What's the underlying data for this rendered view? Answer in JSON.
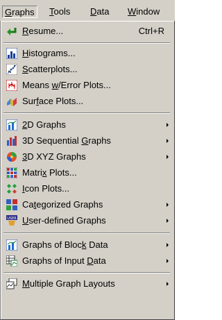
{
  "menubar": {
    "items": [
      {
        "pre": "",
        "ul": "G",
        "post": "raphs"
      },
      {
        "pre": "",
        "ul": "T",
        "post": "ools"
      },
      {
        "pre": "",
        "ul": "D",
        "post": "ata"
      },
      {
        "pre": "",
        "ul": "W",
        "post": "indow"
      }
    ]
  },
  "menu": {
    "resume": {
      "pre": "",
      "ul": "R",
      "post": "esume...",
      "shortcut": "Ctrl+R",
      "icon": "resume-arrow-icon"
    },
    "histograms": {
      "pre": "",
      "ul": "H",
      "post": "istograms...",
      "icon": "histogram-icon"
    },
    "scatterplots": {
      "pre": "",
      "ul": "S",
      "post": "catterplots...",
      "icon": "scatterplot-icon"
    },
    "means": {
      "pre": "Means ",
      "ul": "w",
      "post": "/Error Plots...",
      "icon": "means-error-icon"
    },
    "surface": {
      "pre": "Sur",
      "ul": "f",
      "post": "ace Plots...",
      "icon": "surface-plot-icon"
    },
    "graphs2d": {
      "pre": "",
      "ul": "2",
      "post": "D Graphs",
      "icon": "2d-graph-icon"
    },
    "seq3d": {
      "pre": "3D Sequential ",
      "ul": "G",
      "post": "raphs",
      "icon": "3d-sequential-icon"
    },
    "xyz3d": {
      "pre": "",
      "ul": "3",
      "post": "D XYZ Graphs",
      "icon": "3d-xyz-icon"
    },
    "matrix": {
      "pre": "Matri",
      "ul": "x",
      "post": " Plots...",
      "icon": "matrix-plot-icon"
    },
    "icon_plots": {
      "pre": "",
      "ul": "I",
      "post": "con Plots...",
      "icon": "icon-plot-icon"
    },
    "categorized": {
      "pre": "Ca",
      "ul": "t",
      "post": "egorized Graphs",
      "icon": "categorized-icon"
    },
    "user_defined": {
      "pre": "",
      "ul": "U",
      "post": "ser-defined Graphs",
      "icon": "user-defined-icon"
    },
    "block_data": {
      "pre": "Graphs of Bloc",
      "ul": "k",
      "post": " Data",
      "icon": "block-data-icon"
    },
    "input_data": {
      "pre": "Graphs of Input ",
      "ul": "D",
      "post": "ata",
      "icon": "input-data-icon"
    },
    "multiple": {
      "pre": "",
      "ul": "M",
      "post": "ultiple Graph Layouts",
      "icon": "multiple-layouts-icon"
    }
  },
  "colors": {
    "menu_bg": "#d4d0c8",
    "text": "#000000"
  }
}
